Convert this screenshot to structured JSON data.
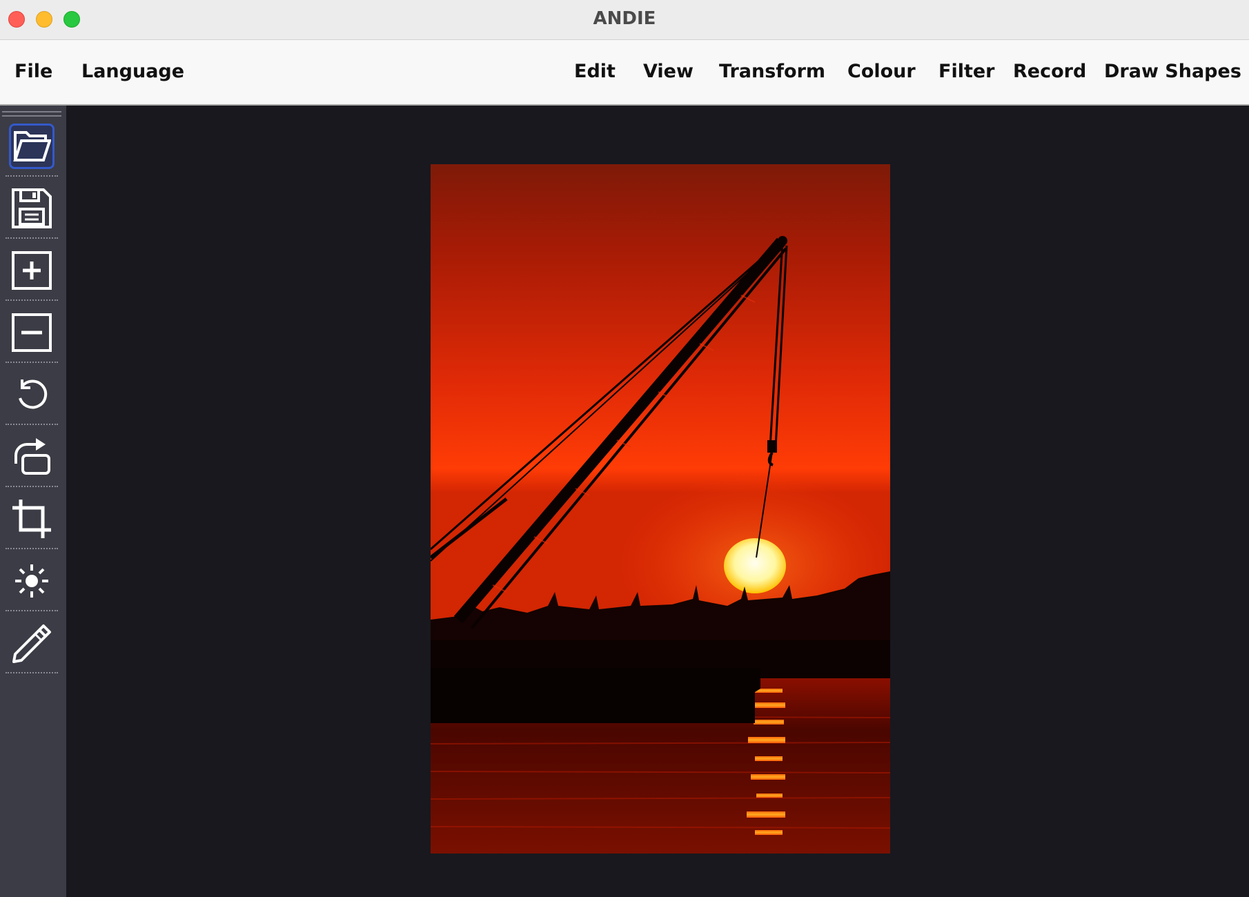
{
  "window": {
    "title": "ANDIE"
  },
  "menubar": {
    "left_items": [
      "File",
      "Language"
    ],
    "right_items": [
      "Edit",
      "View",
      "Transform",
      "Colour",
      "Filter",
      "Record",
      "Draw Shapes"
    ]
  },
  "toolbar": {
    "tools": [
      {
        "icon": "folder-open-icon",
        "active": true
      },
      {
        "icon": "save-icon",
        "active": false
      },
      {
        "icon": "zoom-in-icon",
        "active": false
      },
      {
        "icon": "zoom-out-icon",
        "active": false
      },
      {
        "icon": "undo-icon",
        "active": false
      },
      {
        "icon": "rotate-icon",
        "active": false
      },
      {
        "icon": "crop-icon",
        "active": false
      },
      {
        "icon": "brightness-icon",
        "active": false
      },
      {
        "icon": "pencil-icon",
        "active": false
      }
    ]
  },
  "image": {
    "description_colors": {
      "sky_top": "#7e1a08",
      "sky_mid": "#e02a07",
      "sky_low": "#ff3c06",
      "sun": "#fff8b0",
      "water": "#5a0800"
    }
  },
  "colors": {
    "accent": "#3459c9",
    "toolbar_bg": "#3b3c45",
    "canvas_bg": "#18181e"
  }
}
